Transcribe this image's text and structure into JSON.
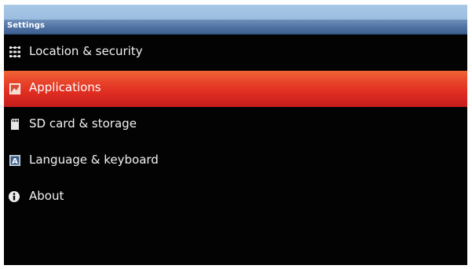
{
  "title_bar": {
    "title": "Settings"
  },
  "settings_list": {
    "items": [
      {
        "label": "Location & security",
        "icon": "grid-dots-icon",
        "selected": false
      },
      {
        "label": "Applications",
        "icon": "applications-icon",
        "selected": true
      },
      {
        "label": "SD card & storage",
        "icon": "sd-card-icon",
        "selected": false
      },
      {
        "label": "Language & keyboard",
        "icon": "keyboard-letter-icon",
        "selected": false
      },
      {
        "label": "About",
        "icon": "info-icon",
        "selected": false
      }
    ]
  },
  "colors": {
    "selection": "#e02d22",
    "title_bar": "#4f72a2",
    "background": "#030303"
  }
}
